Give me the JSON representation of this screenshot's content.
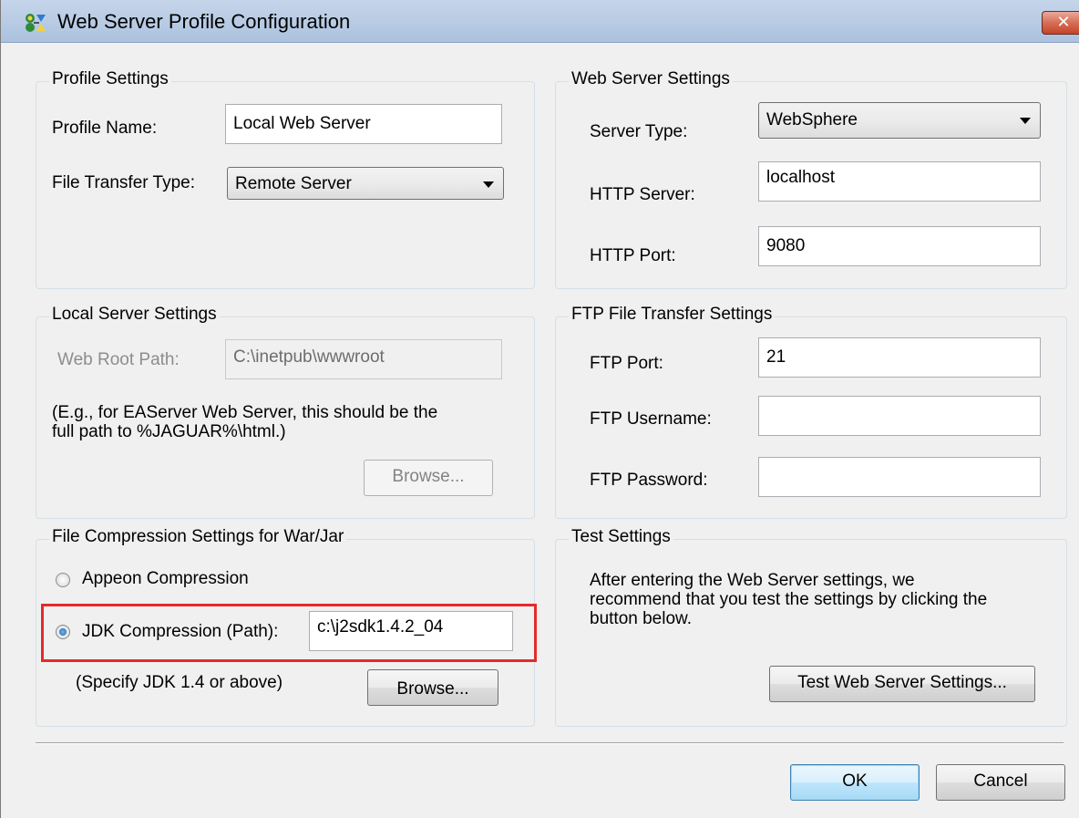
{
  "window": {
    "title": "Web Server Profile Configuration",
    "close_symbol": "✕"
  },
  "profile": {
    "group_label": "Profile Settings",
    "name_label": "Profile Name:",
    "name_value": "Local Web Server",
    "transfer_label": "File Transfer Type:",
    "transfer_value": "Remote Server"
  },
  "web_server": {
    "group_label": "Web Server Settings",
    "server_type_label": "Server Type:",
    "server_type_value": "WebSphere",
    "http_server_label": "HTTP Server:",
    "http_server_value": "localhost",
    "http_port_label": "HTTP Port:",
    "http_port_value": "9080"
  },
  "local_server": {
    "group_label": "Local Server Settings",
    "web_root_label": "Web Root Path:",
    "web_root_value": "C:\\inetpub\\wwwroot",
    "hint_line1": "(E.g., for EAServer Web Server, this should be the",
    "hint_line2": "full path to %JAGUAR%\\html.)",
    "browse_label": "Browse..."
  },
  "ftp": {
    "group_label": "FTP File Transfer Settings",
    "port_label": "FTP Port:",
    "port_value": "21",
    "username_label": "FTP Username:",
    "username_value": "",
    "password_label": "FTP Password:",
    "password_value": ""
  },
  "compression": {
    "group_label": "File Compression Settings for War/Jar",
    "appeon_label": "Appeon Compression",
    "jdk_label": "JDK Compression (Path):",
    "jdk_value": "c:\\j2sdk1.4.2_04",
    "note": "(Specify JDK 1.4 or above)",
    "browse_label": "Browse...",
    "selected": "jdk"
  },
  "test": {
    "group_label": "Test Settings",
    "line1": "After entering the Web Server settings, we",
    "line2": "recommend that you test the settings by clicking the",
    "line3": "button below.",
    "button_label": "Test Web Server Settings..."
  },
  "footer": {
    "ok_label": "OK",
    "cancel_label": "Cancel"
  },
  "colors": {
    "highlight": "#e32b2b",
    "dialog_bg": "#f0f0f0"
  }
}
